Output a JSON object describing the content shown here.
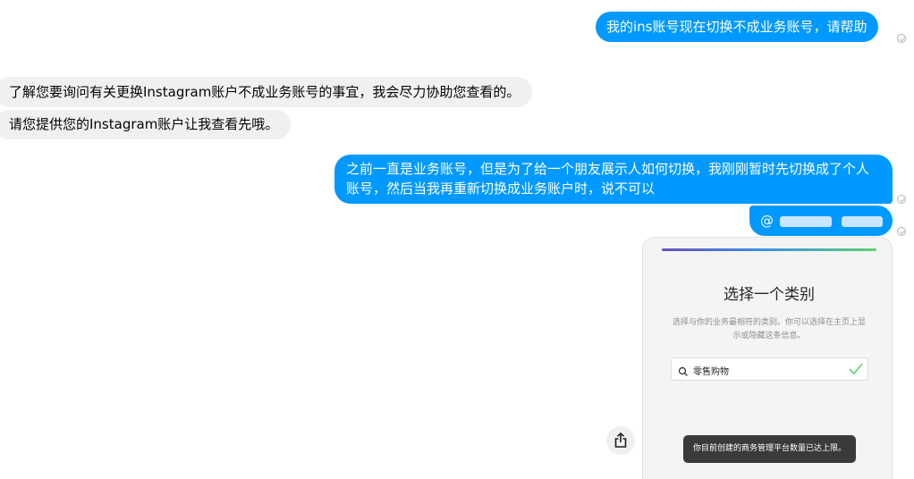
{
  "messages": {
    "m1": "我的ins账号现在切换不成业务账号，请帮助",
    "m2": "了解您要询问有关更换Instagram账户不成业务账号的事宜，我会尽力协助您查看的。",
    "m3": "请您提供您的Instagram账户让我查看先哦。",
    "m4": "之前一直是业务账号，但是为了给一个朋友展示人如何切换，我刚刚暂时先切换成了个人账号，然后当我再重新切换成业务账户时，说不可以",
    "m5_prefix": "@"
  },
  "attachment": {
    "title": "选择一个类别",
    "description": "选择与你的业务最相符的类别。你可以选择在主页上显示或隐藏这条信息。",
    "search_value": "零售购物",
    "toast": "你目前创建的商务管理平台数量已达上限。"
  },
  "icons": {
    "seen": "seen-check-icon",
    "share": "share-icon",
    "search": "search-icon",
    "check": "check-icon"
  },
  "colors": {
    "outgoing": "#0099ff",
    "incoming": "#f0f0f0"
  }
}
